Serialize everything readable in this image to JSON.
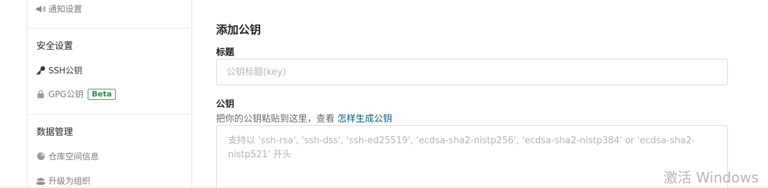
{
  "sidebar": {
    "notify_label": "通知设置",
    "security_section": "安全设置",
    "ssh_label": "SSH公钥",
    "gpg_label": "GPG公钥",
    "gpg_badge": "Beta",
    "data_section": "数据管理",
    "repo_space_label": "仓库空间信息",
    "upgrade_org_label": "升级为组织"
  },
  "form": {
    "heading": "添加公钥",
    "title_label": "标题",
    "title_placeholder": "公钥标题(key)",
    "key_label": "公钥",
    "hint_text": "把你的公钥粘贴到这里，查看 ",
    "hint_link": "怎样生成公钥",
    "key_placeholder": "支持以 'ssh-rsa', 'ssh-dss', 'ssh-ed25519', 'ecdsa-sha2-nistp256', 'ecdsa-sha2-nistp384' or 'ecdsa-sha2-nistp521' 开头"
  },
  "system": {
    "watermark": "激活 Windows"
  },
  "colors": {
    "link": "#005980",
    "beta_green": "#3aa657",
    "border": "#dcdcdc"
  }
}
